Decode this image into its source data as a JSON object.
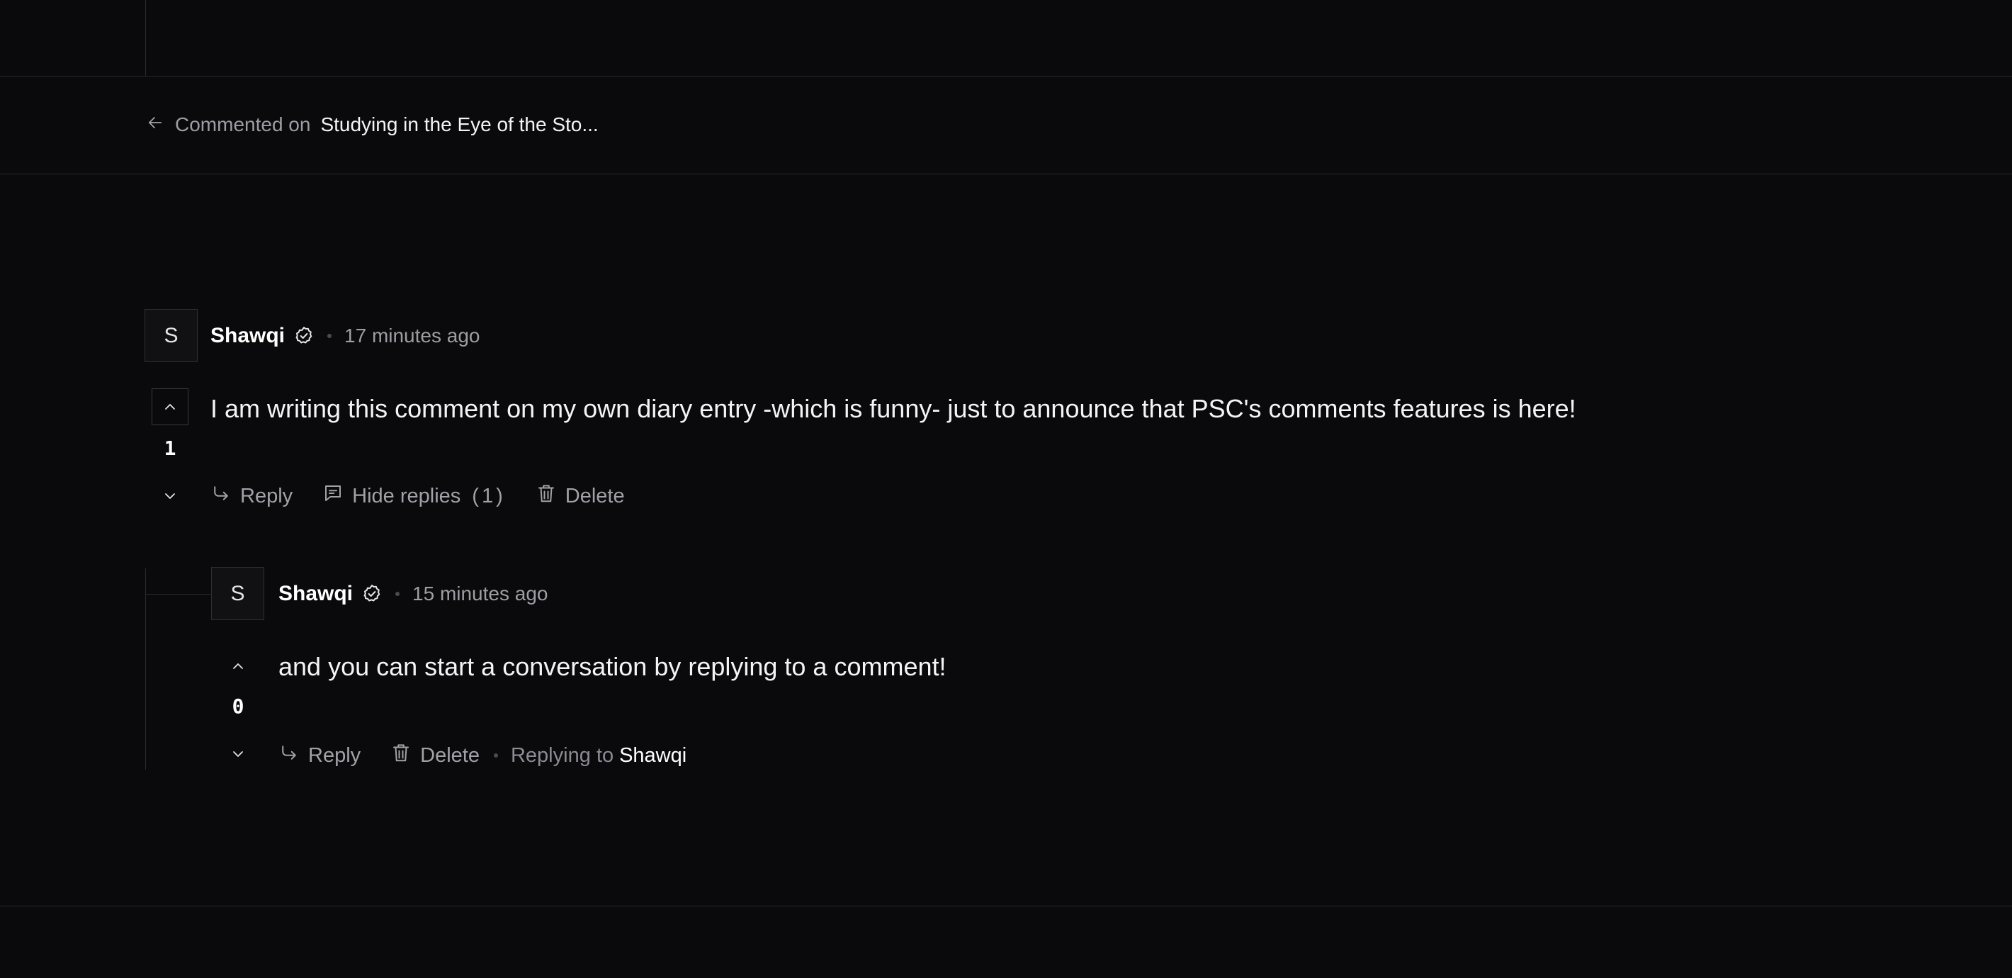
{
  "breadcrumb": {
    "prefix": "Commented on",
    "target": "Studying in the Eye of the Sto..."
  },
  "comments": [
    {
      "avatar_letter": "S",
      "author": "Shawqi",
      "verified": true,
      "time": "17 minutes ago",
      "votes": "1",
      "body": "I am writing this comment on my own diary entry -which is funny- just to announce that PSC's comments features is here!",
      "actions": {
        "reply": "Reply",
        "hide_replies": "Hide replies",
        "replies_count": "(1)",
        "delete": "Delete"
      }
    },
    {
      "avatar_letter": "S",
      "author": "Shawqi",
      "verified": true,
      "time": "15 minutes ago",
      "votes": "0",
      "body": "and you can start a conversation by replying to a comment!",
      "actions": {
        "reply": "Reply",
        "delete": "Delete",
        "replying_to_label": "Replying to",
        "replying_to_name": "Shawqi"
      }
    }
  ],
  "icons": {
    "back": "arrow-left-icon",
    "verified": "check-badge-icon",
    "upvote": "chevron-up-icon",
    "downvote": "chevron-down-icon",
    "reply": "reply-arrow-icon",
    "replies": "message-square-icon",
    "delete": "trash-icon"
  }
}
